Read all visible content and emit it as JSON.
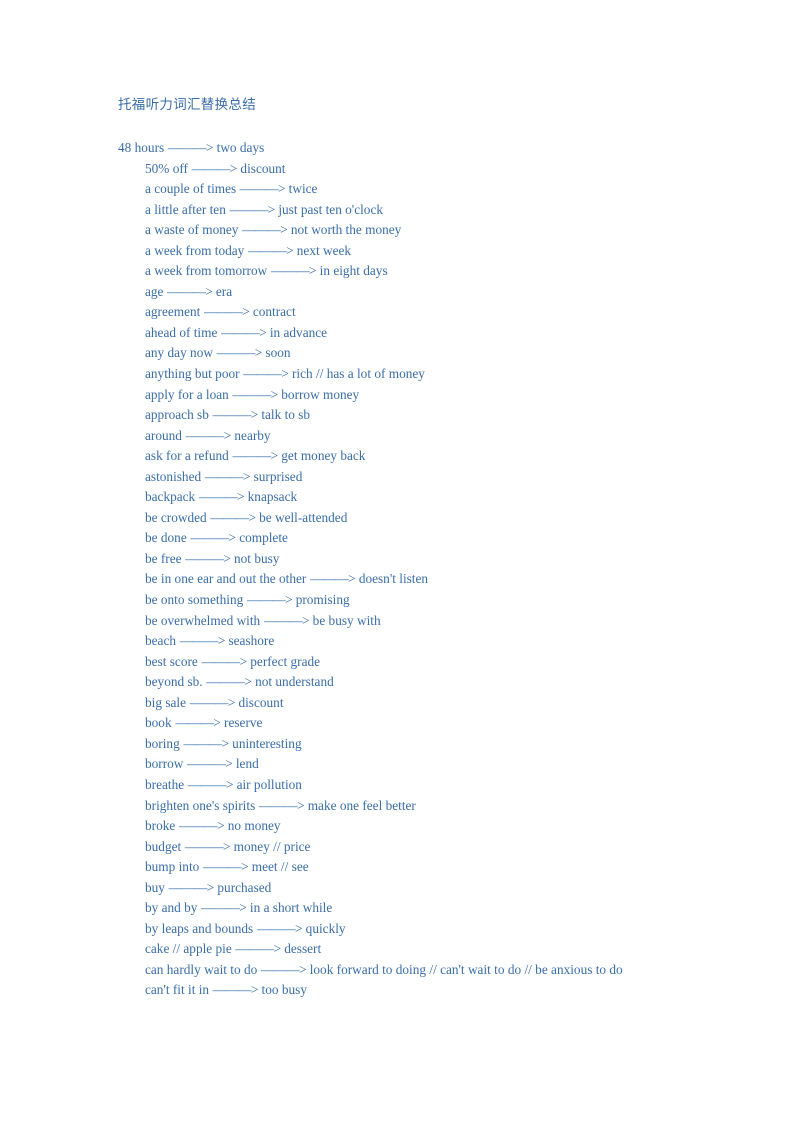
{
  "document": {
    "title": "托福听力词汇替换总结",
    "arrow": "———>",
    "text_color": "#3a6ea8",
    "background_color": "#ffffff",
    "entries": [
      {
        "source": "48 hours",
        "target": "two days"
      },
      {
        "source": "50% off",
        "target": "discount"
      },
      {
        "source": "a couple of times",
        "target": "twice"
      },
      {
        "source": "a little after ten",
        "target": "just past ten o'clock"
      },
      {
        "source": "a waste of money",
        "target": "not worth the money"
      },
      {
        "source": "a week from today",
        "target": "next week"
      },
      {
        "source": "a week from tomorrow",
        "target": "in eight days"
      },
      {
        "source": "age",
        "target": "era"
      },
      {
        "source": "agreement",
        "target": "contract"
      },
      {
        "source": "ahead of time",
        "target": "in advance"
      },
      {
        "source": "any day now",
        "target": "soon"
      },
      {
        "source": "anything but poor",
        "target": "rich // has a lot of money"
      },
      {
        "source": "apply for a loan",
        "target": "borrow money"
      },
      {
        "source": "approach sb",
        "target": "talk to sb"
      },
      {
        "source": "around",
        "target": "nearby"
      },
      {
        "source": "ask for a refund",
        "target": "get money back"
      },
      {
        "source": "astonished",
        "target": "surprised"
      },
      {
        "source": "backpack",
        "target": "knapsack"
      },
      {
        "source": "be crowded",
        "target": "be well-attended"
      },
      {
        "source": "be done",
        "target": "complete"
      },
      {
        "source": "be free",
        "target": "not busy"
      },
      {
        "source": "be in one ear and out the other",
        "target": "doesn't listen"
      },
      {
        "source": "be onto something",
        "target": "promising"
      },
      {
        "source": "be overwhelmed with",
        "target": "be busy with"
      },
      {
        "source": "beach",
        "target": "seashore"
      },
      {
        "source": "best score",
        "target": "perfect grade"
      },
      {
        "source": "beyond sb.",
        "target": "not understand"
      },
      {
        "source": "big sale",
        "target": "discount"
      },
      {
        "source": "book",
        "target": "reserve"
      },
      {
        "source": "boring",
        "target": "uninteresting"
      },
      {
        "source": "borrow",
        "target": "lend"
      },
      {
        "source": "breathe",
        "target": "air pollution"
      },
      {
        "source": "brighten one's spirits",
        "target": "make one feel better"
      },
      {
        "source": "broke",
        "target": "no money"
      },
      {
        "source": "budget",
        "target": "money // price"
      },
      {
        "source": "bump into",
        "target": "meet // see"
      },
      {
        "source": "buy",
        "target": "purchased"
      },
      {
        "source": "by and by",
        "target": "in a short while"
      },
      {
        "source": "by leaps and bounds",
        "target": "quickly"
      },
      {
        "source": "cake // apple pie",
        "target": "dessert"
      },
      {
        "source": "can hardly wait to do",
        "target": "look forward to doing // can't wait to do // be anxious to do"
      },
      {
        "source": "can't fit it in",
        "target": "too busy"
      }
    ]
  }
}
